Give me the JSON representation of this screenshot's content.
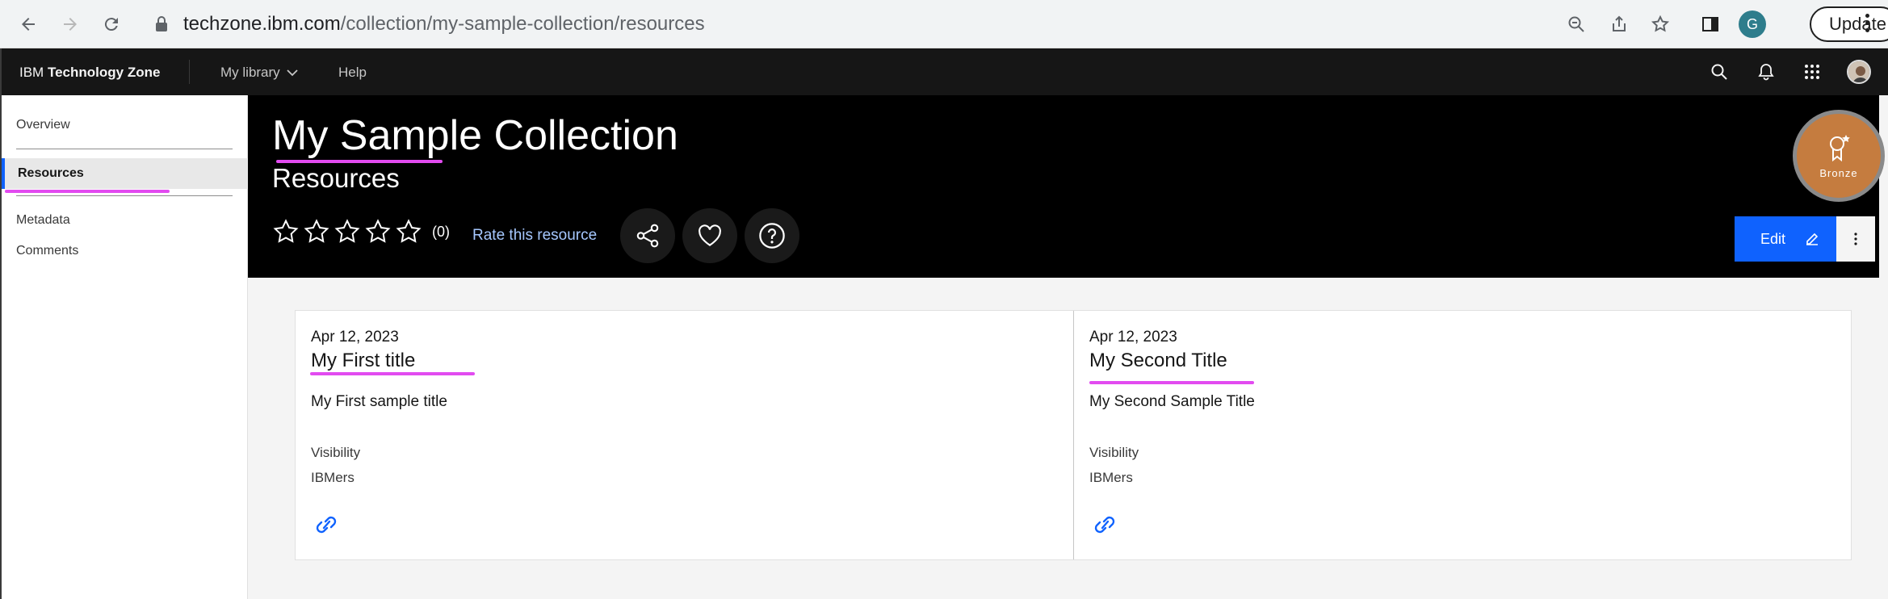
{
  "browser": {
    "url_host": "techzone.ibm.com",
    "url_path": "/collection/my-sample-collection/resources",
    "profile_initial": "G",
    "update_label": "Update",
    "icons": [
      "back-icon",
      "forward-icon",
      "reload-icon",
      "lock-icon",
      "zoom-icon",
      "share-icon",
      "bookmark-star-icon",
      "sidepanel-icon",
      "menu-kebab-icon"
    ]
  },
  "topnav": {
    "brand_prefix": "IBM",
    "brand_name": "Technology Zone",
    "links": [
      {
        "label": "My library",
        "has_dropdown": true
      },
      {
        "label": "Help"
      }
    ],
    "icons": [
      "search-icon",
      "notification-icon",
      "app-switcher-icon",
      "user-avatar"
    ]
  },
  "sidebar": {
    "items": [
      {
        "label": "Overview",
        "active": false
      },
      {
        "label": "Resources",
        "active": true
      },
      {
        "label": "Metadata",
        "active": false
      },
      {
        "label": "Comments",
        "active": false
      }
    ]
  },
  "hero": {
    "title": "My Sample Collection",
    "subtitle": "Resources",
    "rating_count": "(0)",
    "stars_filled": 0,
    "stars_total": 5,
    "rate_label": "Rate this resource",
    "badge_label": "Bronze",
    "edit_label": "Edit"
  },
  "resources": [
    {
      "date": "Apr 12, 2023",
      "title": "My First title",
      "description": "My First sample title",
      "visibility_label": "Visibility",
      "visibility_value": "IBMers"
    },
    {
      "date": "Apr 12, 2023",
      "title": "My Second Title",
      "description": "My Second Sample Title",
      "visibility_label": "Visibility",
      "visibility_value": "IBMers"
    }
  ],
  "colors": {
    "accent": "#0f62fe",
    "highlight": "#e24bf0",
    "badge": "#c57c3f",
    "hero_bg": "#000000",
    "nav_bg": "#161616"
  }
}
